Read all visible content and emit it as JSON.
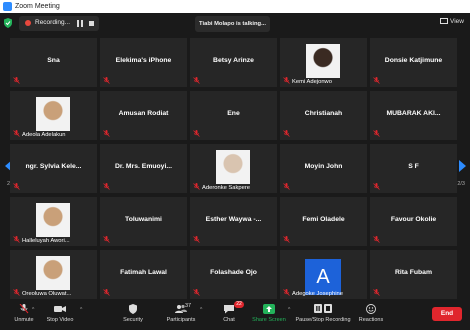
{
  "window": {
    "title": "Zoom Meeting"
  },
  "recording": {
    "label": "Recording..."
  },
  "talking": {
    "text": "Tiabi Molapo is talking..."
  },
  "view": {
    "label": "View"
  },
  "pager": {
    "left": "2/3",
    "right": "2/3"
  },
  "colors": {
    "accent": "#2d8cff",
    "mic_muted": "#e0262d",
    "end": "#e0262d",
    "avatar": "#1d62d9"
  },
  "tiles": [
    {
      "name": "Sna",
      "caption": "",
      "photo": false
    },
    {
      "name": "Elekima's iPhone",
      "caption": "",
      "photo": false
    },
    {
      "name": "Betsy Arinze",
      "caption": "",
      "photo": false
    },
    {
      "name": "",
      "caption": "Kemi Adejonwo",
      "photo": true
    },
    {
      "name": "Donsie Katjimune",
      "caption": "",
      "photo": false
    },
    {
      "name": "",
      "caption": "Adeola Adelakun",
      "photo": true
    },
    {
      "name": "Amusan Rodiat",
      "caption": "",
      "photo": false
    },
    {
      "name": "Ene",
      "caption": "",
      "photo": false
    },
    {
      "name": "Christianah",
      "caption": "",
      "photo": false
    },
    {
      "name": "MUBARAK AKI...",
      "caption": "",
      "photo": false
    },
    {
      "name": "ngr. Sylvia Kele...",
      "caption": "",
      "photo": false
    },
    {
      "name": "Dr. Mrs. Emuoyi...",
      "caption": "",
      "photo": false
    },
    {
      "name": "",
      "caption": "Aderonke Sakpere",
      "photo": true
    },
    {
      "name": "Moyin John",
      "caption": "",
      "photo": false
    },
    {
      "name": "S F",
      "caption": "",
      "photo": false
    },
    {
      "name": "",
      "caption": "Halleluyah Awori...",
      "photo": true
    },
    {
      "name": "Toluwanimi",
      "caption": "",
      "photo": false
    },
    {
      "name": "Esther Waywa -...",
      "caption": "",
      "photo": false
    },
    {
      "name": "Femi Oladele",
      "caption": "",
      "photo": false
    },
    {
      "name": "Favour Okolie",
      "caption": "",
      "photo": false
    },
    {
      "name": "",
      "caption": "Oreoluwa Oluwat...",
      "photo": true
    },
    {
      "name": "Fatimah Lawal",
      "caption": "",
      "photo": false
    },
    {
      "name": "Folashade Ojo",
      "caption": "",
      "photo": false
    },
    {
      "name": "",
      "caption": "Adegoke Josephine",
      "photo": false,
      "avatar": "A"
    },
    {
      "name": "Rita Fubam",
      "caption": "",
      "photo": false
    }
  ],
  "toolbar": {
    "unmute": "Unmute",
    "stop_video": "Stop Video",
    "security": "Security",
    "participants": "Participants",
    "participants_count": "37",
    "chat": "Chat",
    "chat_badge": "22",
    "share_screen": "Share Screen",
    "pause_recording": "Pause/Stop Recording",
    "reactions": "Reactions",
    "end": "End"
  }
}
